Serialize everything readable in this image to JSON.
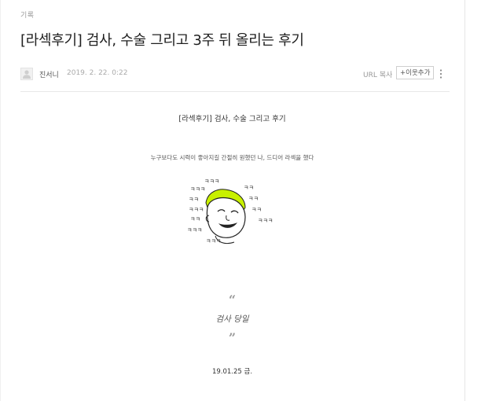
{
  "post": {
    "category": "기록",
    "title": "[라섹후기] 검사, 수술 그리고 3주 뒤 올리는 후기"
  },
  "meta": {
    "author": "진서니",
    "date": "2019. 2. 22. 0:22",
    "url_copy": "URL 복사",
    "neighbor_add": "+이웃추가",
    "avatar_icon": "user-silhouette-icon",
    "more_icon": "vertical-dots-icon"
  },
  "content": {
    "heading": "[라섹후기] 검사, 수술 그리고 후기",
    "intro": "누구보다도 시력이 좋아지길 간절히 원했던 나, 드디어 라섹을 했다",
    "laughs": [
      "ㅋㅋㅋ",
      "ㅋㅋㅋ",
      "ㅋㅋ",
      "ㅋㅋ",
      "ㅋㅋㅋ",
      "ㅋㅋ",
      "ㅋㅋ",
      "ㅋㅋ",
      "ㅋㅋㅋ",
      "ㅋㅋㅋ",
      "ㅋㅋㅋ"
    ],
    "quote_open": "“",
    "quote": "검사 당일",
    "quote_close": "”",
    "date_line": "19.01.25 금."
  },
  "colors": {
    "accent_hat": "#c8f000",
    "text": "#333333",
    "muted": "#9a9a9a",
    "border": "#cfcfcf"
  }
}
